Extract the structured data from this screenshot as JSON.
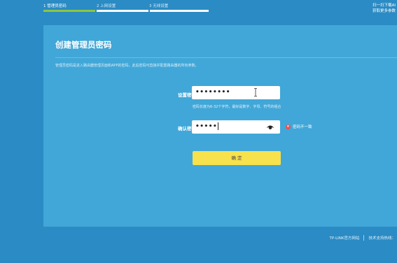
{
  "steps": [
    {
      "label": "1 管理员密码",
      "active": true
    },
    {
      "label": "2 上网设置",
      "active": false
    },
    {
      "label": "3 无线设置",
      "active": false
    }
  ],
  "corner": {
    "line1": "扫一扫下载AI",
    "line2": "获取更多参数"
  },
  "panel": {
    "title": "创建管理员密码",
    "description": "管理员密码是进入路由器管理页面和APP的密码，此后密码可直接并配置路由器的所有参数。"
  },
  "form": {
    "set_password": {
      "label": "设置密码",
      "value": "••••••••"
    },
    "password_hint": "密码长度为6-32个字符，最好是数字、字母、符号的组合",
    "confirm_password": {
      "label": "确认密码",
      "value": "•••••"
    },
    "error_text": "密码不一致",
    "submit_label": "确 定"
  },
  "footer": {
    "site_link": "TP-LINK官方网站",
    "hotline": "技术支持热线："
  },
  "colors": {
    "background": "#2b8bc4",
    "panel": "#41a7d8",
    "button": "#f7e14c",
    "error": "#f04e4e",
    "progress_done": "#8cc63f"
  }
}
